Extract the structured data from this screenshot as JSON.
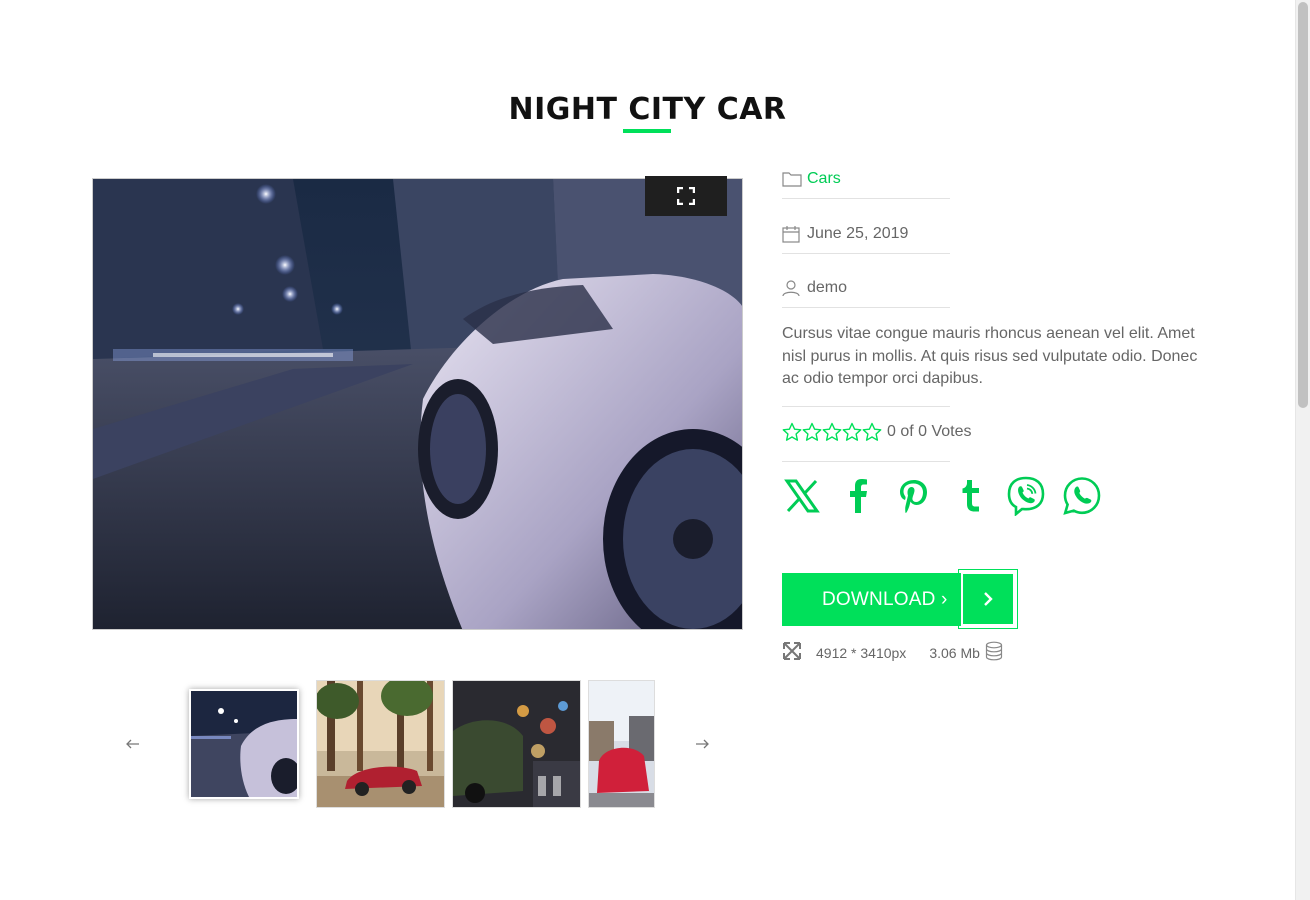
{
  "page": {
    "title": "NIGHT CITY CAR"
  },
  "meta": {
    "category": "Cars",
    "date": "June 25, 2019",
    "author": "demo"
  },
  "description": "Cursus vitae congue mauris rhoncus aenean vel elit. Amet nisl purus in mollis. At quis risus sed vulputate odio. Donec ac odio tempor orci dapibus.",
  "rating": {
    "text": "0 of 0 Votes",
    "value": 0,
    "max": 5
  },
  "share": {
    "icons": [
      "x-icon",
      "facebook-icon",
      "pinterest-icon",
      "tumblr-icon",
      "viber-icon",
      "whatsapp-icon"
    ]
  },
  "download": {
    "label": "DOWNLOAD ›"
  },
  "file": {
    "dimensions": "4912 * 3410px",
    "size": "3.06 Mb"
  },
  "thumbnails": [
    "night-city-car",
    "red-car-forest",
    "mini-car-city-lights",
    "red-car-traffic"
  ],
  "colors": {
    "accent": "#00e05a",
    "text": "#666666",
    "title": "#111111"
  }
}
